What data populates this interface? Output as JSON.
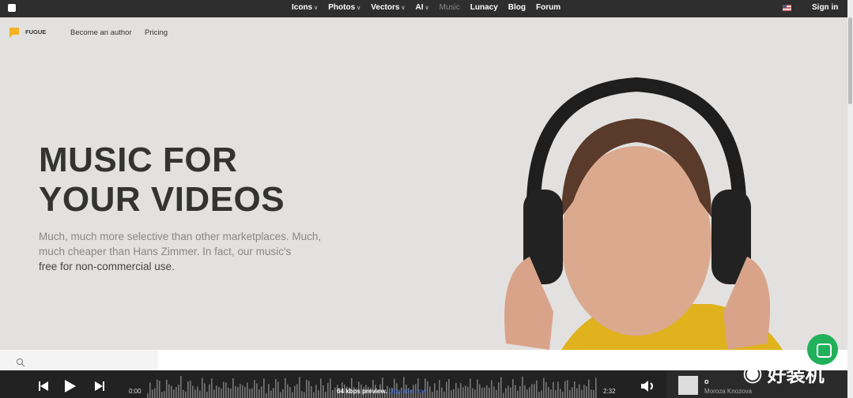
{
  "topnav": {
    "items": [
      {
        "label": "Icons",
        "dropdown": true
      },
      {
        "label": "Photos",
        "dropdown": true
      },
      {
        "label": "Vectors",
        "dropdown": true
      },
      {
        "label": "AI",
        "dropdown": true
      },
      {
        "label": "Music",
        "active": true
      },
      {
        "label": "Lunacy"
      },
      {
        "label": "Blog"
      },
      {
        "label": "Forum"
      }
    ],
    "sign_in": "Sign in"
  },
  "subnav": {
    "brand": "FUGUE",
    "links": [
      "Become an author",
      "Pricing"
    ]
  },
  "hero": {
    "title_line1": "MUSIC FOR",
    "title_line2": "YOUR VIDEOS",
    "desc1": "Much, much more selective than other marketplaces. Much, much cheaper than Hans Zimmer. In fact, our music's",
    "desc2": "free for non-commercial use."
  },
  "player": {
    "current_time": "0:00",
    "duration": "2:32",
    "preview_text": "64 kbps preview.",
    "upgrade_link": "Upgrade now",
    "track_title": "o",
    "track_artist": "Moroza Knozova"
  },
  "watermark": "好装机",
  "colors": {
    "accent": "#f5b323",
    "chat": "#20b15a",
    "link": "#3d6dd8"
  }
}
